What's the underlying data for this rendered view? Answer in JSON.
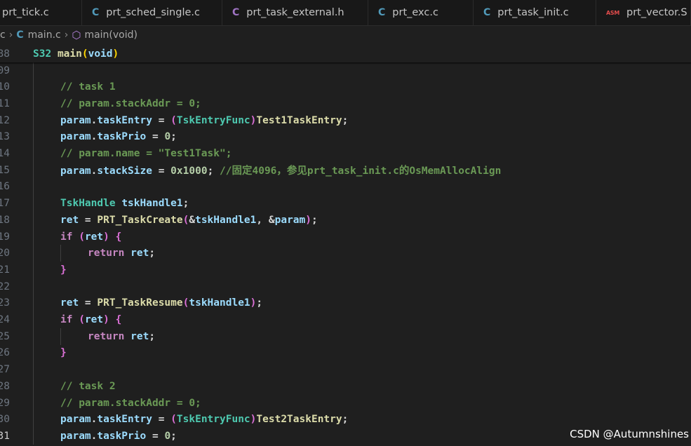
{
  "tabs": [
    {
      "label": "prt_tick.c",
      "icon": "c-file-icon",
      "glyph": "",
      "kind": "c"
    },
    {
      "label": "prt_sched_single.c",
      "icon": "c-file-icon",
      "glyph": "C",
      "kind": "c"
    },
    {
      "label": "prt_task_external.h",
      "icon": "h-file-icon",
      "glyph": "C",
      "kind": "h"
    },
    {
      "label": "prt_exc.c",
      "icon": "c-file-icon",
      "glyph": "C",
      "kind": "c"
    },
    {
      "label": "prt_task_init.c",
      "icon": "c-file-icon",
      "glyph": "C",
      "kind": "c"
    },
    {
      "label": "prt_vector.S",
      "icon": "asm-file-icon",
      "glyph": "ASM",
      "kind": "asm"
    }
  ],
  "breadcrumb": {
    "lead": "c",
    "file_glyph": "C",
    "file": "main.c",
    "symbol_glyph": "⬡",
    "symbol": "main(void)"
  },
  "colors": {
    "keyword_type": "#4ec9b0",
    "variable": "#9cdcfe",
    "function": "#dcdcaa",
    "comment": "#6a9955",
    "control": "#c586c0",
    "number": "#b5cea8",
    "string": "#ce9178",
    "paren": "#da70d6",
    "brace": "#ffd700",
    "plain": "#d4d4d4"
  },
  "lines": [
    {
      "num": "88",
      "indent": 0,
      "sticky": true,
      "tokens": [
        {
          "t": "S32",
          "c": "keyword_type"
        },
        {
          "t": " "
        },
        {
          "t": "main",
          "c": "function"
        },
        {
          "t": "(",
          "c": "brace"
        },
        {
          "t": "void",
          "c": "variable"
        },
        {
          "t": ")",
          "c": "brace"
        }
      ]
    },
    {
      "num": "09",
      "indent": 0,
      "tokens": []
    },
    {
      "num": "10",
      "indent": 1,
      "tokens": [
        {
          "t": "// task 1",
          "c": "comment"
        }
      ]
    },
    {
      "num": "11",
      "indent": 1,
      "tokens": [
        {
          "t": "// param.stackAddr = 0;",
          "c": "comment"
        }
      ]
    },
    {
      "num": "12",
      "indent": 1,
      "tokens": [
        {
          "t": "param",
          "c": "variable"
        },
        {
          "t": "."
        },
        {
          "t": "taskEntry",
          "c": "variable"
        },
        {
          "t": " = "
        },
        {
          "t": "(",
          "c": "paren"
        },
        {
          "t": "TskEntryFunc",
          "c": "keyword_type"
        },
        {
          "t": ")",
          "c": "paren"
        },
        {
          "t": "Test1TaskEntry",
          "c": "function"
        },
        {
          "t": ";"
        }
      ]
    },
    {
      "num": "13",
      "indent": 1,
      "tokens": [
        {
          "t": "param",
          "c": "variable"
        },
        {
          "t": "."
        },
        {
          "t": "taskPrio",
          "c": "variable"
        },
        {
          "t": " = "
        },
        {
          "t": "0",
          "c": "number"
        },
        {
          "t": ";"
        }
      ]
    },
    {
      "num": "14",
      "indent": 1,
      "tokens": [
        {
          "t": "// param.name = \"Test1Task\";",
          "c": "comment"
        }
      ]
    },
    {
      "num": "15",
      "indent": 1,
      "tokens": [
        {
          "t": "param",
          "c": "variable"
        },
        {
          "t": "."
        },
        {
          "t": "stackSize",
          "c": "variable"
        },
        {
          "t": " = "
        },
        {
          "t": "0x1000",
          "c": "number"
        },
        {
          "t": "; "
        },
        {
          "t": "//固定4096，参见prt_task_init.c的OsMemAllocAlign",
          "c": "comment"
        }
      ]
    },
    {
      "num": "16",
      "indent": 0,
      "tokens": []
    },
    {
      "num": "17",
      "indent": 1,
      "tokens": [
        {
          "t": "TskHandle",
          "c": "keyword_type"
        },
        {
          "t": " "
        },
        {
          "t": "tskHandle1",
          "c": "variable"
        },
        {
          "t": ";"
        }
      ]
    },
    {
      "num": "18",
      "indent": 1,
      "tokens": [
        {
          "t": "ret",
          "c": "variable"
        },
        {
          "t": " = "
        },
        {
          "t": "PRT_TaskCreate",
          "c": "function"
        },
        {
          "t": "(",
          "c": "paren"
        },
        {
          "t": "&"
        },
        {
          "t": "tskHandle1",
          "c": "variable"
        },
        {
          "t": ", &"
        },
        {
          "t": "param",
          "c": "variable"
        },
        {
          "t": ")",
          "c": "paren"
        },
        {
          "t": ";"
        }
      ]
    },
    {
      "num": "19",
      "indent": 1,
      "tokens": [
        {
          "t": "if",
          "c": "control"
        },
        {
          "t": " "
        },
        {
          "t": "(",
          "c": "paren"
        },
        {
          "t": "ret",
          "c": "variable"
        },
        {
          "t": ")",
          "c": "paren"
        },
        {
          "t": " "
        },
        {
          "t": "{",
          "c": "paren"
        }
      ]
    },
    {
      "num": "20",
      "indent": 2,
      "tokens": [
        {
          "t": "return",
          "c": "control"
        },
        {
          "t": " "
        },
        {
          "t": "ret",
          "c": "variable"
        },
        {
          "t": ";"
        }
      ]
    },
    {
      "num": "21",
      "indent": 1,
      "tokens": [
        {
          "t": "}",
          "c": "paren"
        }
      ]
    },
    {
      "num": "22",
      "indent": 0,
      "tokens": []
    },
    {
      "num": "23",
      "indent": 1,
      "tokens": [
        {
          "t": "ret",
          "c": "variable"
        },
        {
          "t": " = "
        },
        {
          "t": "PRT_TaskResume",
          "c": "function"
        },
        {
          "t": "(",
          "c": "paren"
        },
        {
          "t": "tskHandle1",
          "c": "variable"
        },
        {
          "t": ")",
          "c": "paren"
        },
        {
          "t": ";"
        }
      ]
    },
    {
      "num": "24",
      "indent": 1,
      "tokens": [
        {
          "t": "if",
          "c": "control"
        },
        {
          "t": " "
        },
        {
          "t": "(",
          "c": "paren"
        },
        {
          "t": "ret",
          "c": "variable"
        },
        {
          "t": ")",
          "c": "paren"
        },
        {
          "t": " "
        },
        {
          "t": "{",
          "c": "paren"
        }
      ]
    },
    {
      "num": "25",
      "indent": 2,
      "tokens": [
        {
          "t": "return",
          "c": "control"
        },
        {
          "t": " "
        },
        {
          "t": "ret",
          "c": "variable"
        },
        {
          "t": ";"
        }
      ]
    },
    {
      "num": "26",
      "indent": 1,
      "tokens": [
        {
          "t": "}",
          "c": "paren"
        }
      ]
    },
    {
      "num": "27",
      "indent": 0,
      "tokens": []
    },
    {
      "num": "28",
      "indent": 1,
      "tokens": [
        {
          "t": "// task 2",
          "c": "comment"
        }
      ]
    },
    {
      "num": "29",
      "indent": 1,
      "tokens": [
        {
          "t": "// param.stackAddr = 0;",
          "c": "comment"
        }
      ]
    },
    {
      "num": "30",
      "indent": 1,
      "tokens": [
        {
          "t": "param",
          "c": "variable"
        },
        {
          "t": "."
        },
        {
          "t": "taskEntry",
          "c": "variable"
        },
        {
          "t": " = "
        },
        {
          "t": "(",
          "c": "paren"
        },
        {
          "t": "TskEntryFunc",
          "c": "keyword_type"
        },
        {
          "t": ")",
          "c": "paren"
        },
        {
          "t": "Test2TaskEntry",
          "c": "function"
        },
        {
          "t": ";"
        }
      ]
    },
    {
      "num": "31",
      "indent": 1,
      "current": true,
      "tokens": [
        {
          "t": "param",
          "c": "variable"
        },
        {
          "t": "."
        },
        {
          "t": "taskPrio",
          "c": "variable"
        },
        {
          "t": " = "
        },
        {
          "t": "0",
          "c": "number"
        },
        {
          "t": ";"
        }
      ]
    }
  ],
  "watermark": "CSDN @Autumnshines"
}
